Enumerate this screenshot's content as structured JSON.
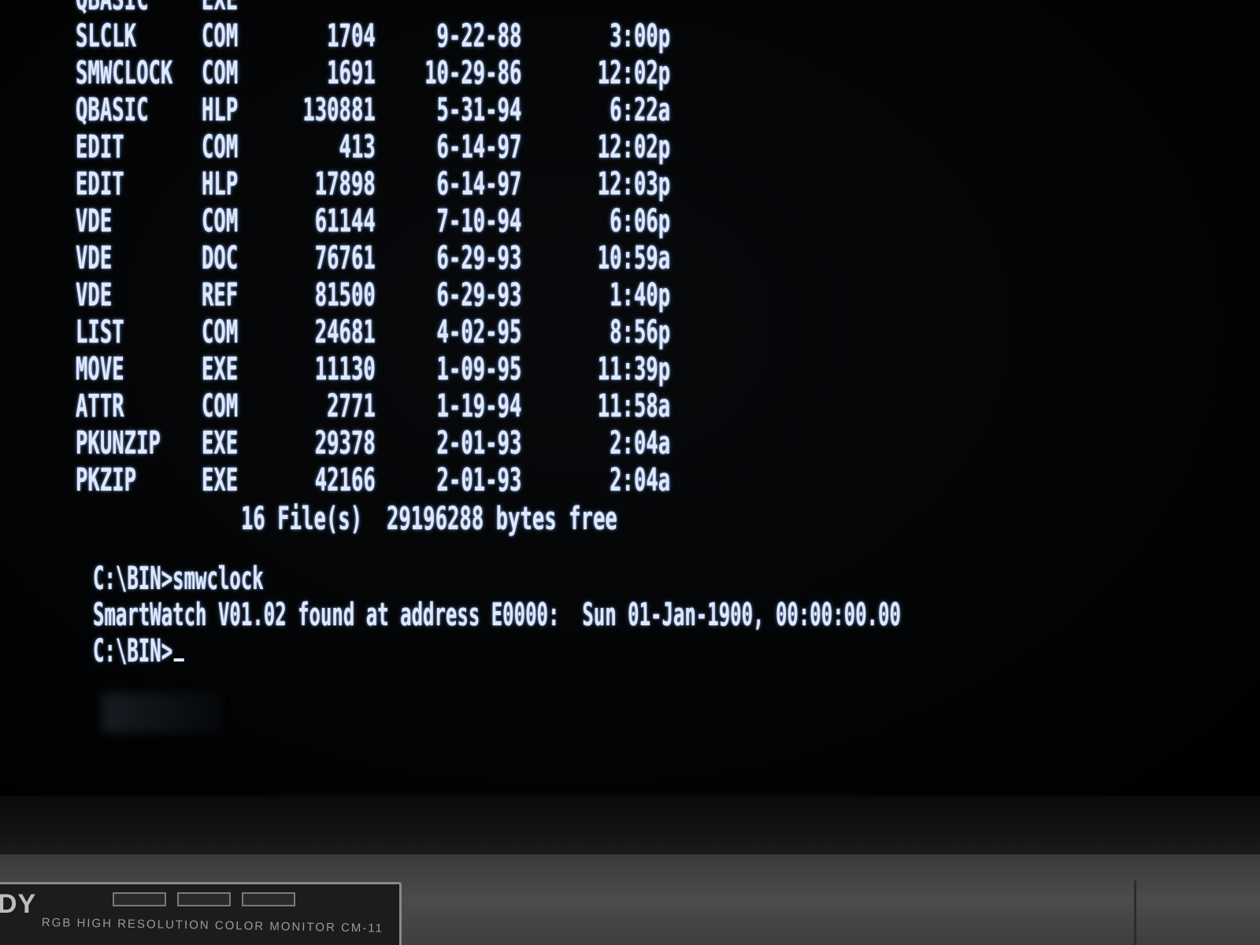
{
  "listing": [
    {
      "name": "QBASIC",
      "ext": "EXE",
      "size": "",
      "date": "",
      "time": ""
    },
    {
      "name": "SLCLK",
      "ext": "COM",
      "size": "1704",
      "date": "9-22-88",
      "time": "3:00p"
    },
    {
      "name": "SMWCLOCK",
      "ext": "COM",
      "size": "1691",
      "date": "10-29-86",
      "time": "12:02p"
    },
    {
      "name": "QBASIC",
      "ext": "HLP",
      "size": "130881",
      "date": "5-31-94",
      "time": "6:22a"
    },
    {
      "name": "EDIT",
      "ext": "COM",
      "size": "413",
      "date": "6-14-97",
      "time": "12:02p"
    },
    {
      "name": "EDIT",
      "ext": "HLP",
      "size": "17898",
      "date": "6-14-97",
      "time": "12:03p"
    },
    {
      "name": "VDE",
      "ext": "COM",
      "size": "61144",
      "date": "7-10-94",
      "time": "6:06p"
    },
    {
      "name": "VDE",
      "ext": "DOC",
      "size": "76761",
      "date": "6-29-93",
      "time": "10:59a"
    },
    {
      "name": "VDE",
      "ext": "REF",
      "size": "81500",
      "date": "6-29-93",
      "time": "1:40p"
    },
    {
      "name": "LIST",
      "ext": "COM",
      "size": "24681",
      "date": "4-02-95",
      "time": "8:56p"
    },
    {
      "name": "MOVE",
      "ext": "EXE",
      "size": "11130",
      "date": "1-09-95",
      "time": "11:39p"
    },
    {
      "name": "ATTR",
      "ext": "COM",
      "size": "2771",
      "date": "1-19-94",
      "time": "11:58a"
    },
    {
      "name": "PKUNZIP",
      "ext": "EXE",
      "size": "29378",
      "date": "2-01-93",
      "time": "2:04a"
    },
    {
      "name": "PKZIP",
      "ext": "EXE",
      "size": "42166",
      "date": "2-01-93",
      "time": "2:04a"
    }
  ],
  "summary": "16 File(s)  29196288 bytes free",
  "console": {
    "prompt_command": "C:\\BIN>smwclock",
    "output": "SmartWatch V01.02 found at address E0000:  Sun 01-Jan-1900, 00:00:00.00",
    "prompt": "C:\\BIN>"
  },
  "bezel": {
    "brand": "DY",
    "tagline": "RGB HIGH RESOLUTION COLOR MONITOR CM-11"
  },
  "colors": {
    "phosphor": "#dde9ff",
    "screen_background": "#000000",
    "bezel": "#3e3e3e"
  }
}
